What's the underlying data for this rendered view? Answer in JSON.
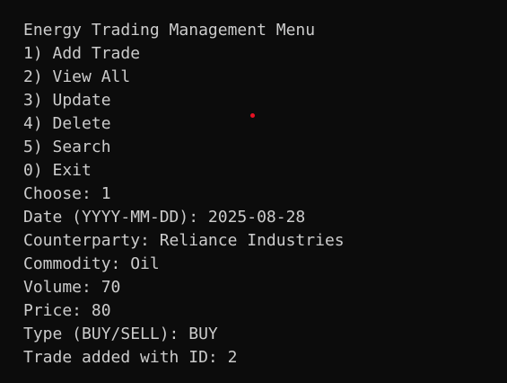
{
  "colors": {
    "background": "#0c0c0c",
    "text": "#cccccc",
    "cursor_dot": "#e81123"
  },
  "terminal": {
    "lines": [
      "Energy Trading Management Menu",
      "1) Add Trade",
      "2) View All",
      "3) Update",
      "4) Delete",
      "5) Search",
      "0) Exit",
      "Choose: 1",
      "Date (YYYY-MM-DD): 2025-08-28",
      "Counterparty: Reliance Industries",
      "Commodity: Oil",
      "Volume: 70",
      "Price: 80",
      "Type (BUY/SELL): BUY",
      "Trade added with ID: 2"
    ]
  }
}
